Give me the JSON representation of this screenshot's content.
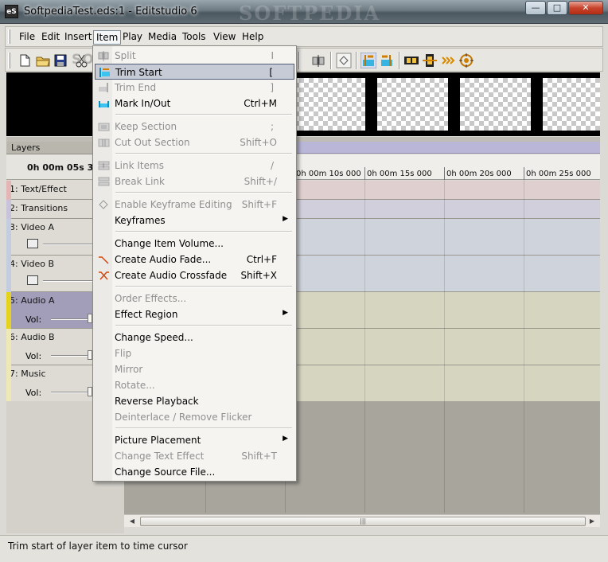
{
  "window": {
    "icon_text": "eS",
    "title": "SoftpediaTest.eds:1 - Editstudio 6",
    "watermark": "SOFTPEDIA",
    "min_label": "—",
    "max_label": "□",
    "close_label": "✕"
  },
  "menubar": {
    "items": [
      "File",
      "Edit",
      "Insert",
      "Item",
      "Play",
      "Media",
      "Tools",
      "View",
      "Help"
    ],
    "active_index": 3
  },
  "toolbar": {
    "watermark": "SOFTPEDIA"
  },
  "layers_panel": {
    "title": "Layers",
    "time": "0h 00m 05s 372",
    "vol_label": "Vol:",
    "layers": [
      {
        "num": "1",
        "name": "Text/Effect"
      },
      {
        "num": "2",
        "name": "Transitions"
      },
      {
        "num": "3",
        "name": "Video A"
      },
      {
        "num": "4",
        "name": "Video B"
      },
      {
        "num": "5",
        "name": "Audio A"
      },
      {
        "num": "6",
        "name": "Audio B"
      },
      {
        "num": "7",
        "name": "Music"
      }
    ]
  },
  "ruler": {
    "labels": [
      "0h 00m 10s 000",
      "0h 00m 15s 000",
      "0h 00m 20s 000",
      "0h 00m 25s 000"
    ]
  },
  "item_menu": {
    "items": [
      {
        "label": "Split",
        "shortcut": "I",
        "disabled": true
      },
      {
        "label": "Trim Start",
        "shortcut": "[",
        "disabled": false,
        "highlight": true
      },
      {
        "label": "Trim End",
        "shortcut": "]",
        "disabled": true
      },
      {
        "label": "Mark In/Out",
        "shortcut": "Ctrl+M",
        "disabled": false
      },
      {
        "label": "Keep Section",
        "shortcut": ";",
        "disabled": true
      },
      {
        "label": "Cut Out Section",
        "shortcut": "Shift+O",
        "disabled": true
      },
      {
        "label": "Link Items",
        "shortcut": "/",
        "disabled": true
      },
      {
        "label": "Break Link",
        "shortcut": "Shift+/",
        "disabled": true
      },
      {
        "label": "Enable Keyframe Editing",
        "shortcut": "Shift+F",
        "disabled": true
      },
      {
        "label": "Keyframes",
        "shortcut": "",
        "disabled": false,
        "submenu": true
      },
      {
        "label": "Change Item Volume...",
        "shortcut": "",
        "disabled": false
      },
      {
        "label": "Create Audio Fade...",
        "shortcut": "Ctrl+F",
        "disabled": false
      },
      {
        "label": "Create Audio Crossfade",
        "shortcut": "Shift+X",
        "disabled": false
      },
      {
        "label": "Order Effects...",
        "shortcut": "",
        "disabled": true
      },
      {
        "label": "Effect Region",
        "shortcut": "",
        "disabled": false,
        "submenu": true
      },
      {
        "label": "Change Speed...",
        "shortcut": "",
        "disabled": false
      },
      {
        "label": "Flip",
        "shortcut": "",
        "disabled": true
      },
      {
        "label": "Mirror",
        "shortcut": "",
        "disabled": true
      },
      {
        "label": "Rotate...",
        "shortcut": "",
        "disabled": true
      },
      {
        "label": "Reverse Playback",
        "shortcut": "",
        "disabled": false
      },
      {
        "label": "Deinterlace / Remove Flicker",
        "shortcut": "",
        "disabled": true
      },
      {
        "label": "Picture Placement",
        "shortcut": "",
        "disabled": false,
        "submenu": true
      },
      {
        "label": "Change Text Effect",
        "shortcut": "Shift+T",
        "disabled": true
      },
      {
        "label": "Change Source File...",
        "shortcut": "",
        "disabled": false
      }
    ]
  },
  "statusbar": {
    "text": "Trim start of layer item to time cursor"
  },
  "colors": {
    "menu_highlight": "#c6cbd6",
    "text_track": "#e0cfcf",
    "transitions_track": "#d2cfdc",
    "video_track": "#cfd4dc",
    "audio_track": "#d6d5c0",
    "selected_layer": "#a29eb9"
  }
}
